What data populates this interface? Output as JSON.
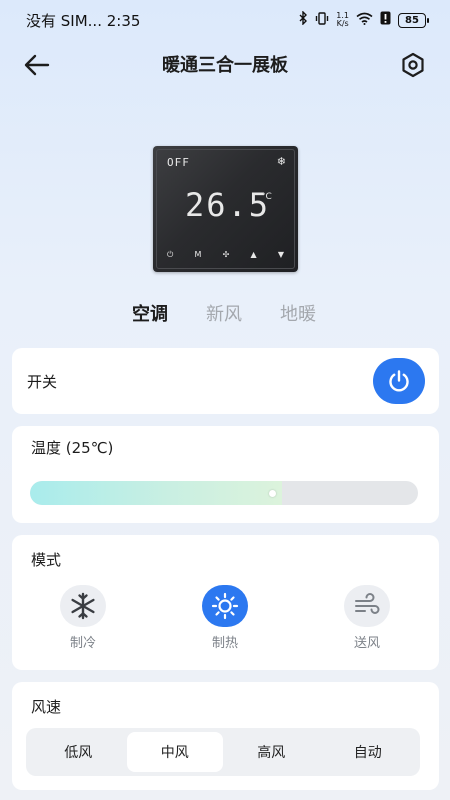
{
  "status_bar": {
    "carrier": "没有 SIM... 2:35",
    "net_speed_value": "1.1",
    "net_speed_unit": "K/s",
    "battery": "85"
  },
  "header": {
    "title": "暖通三合一展板"
  },
  "device_display": {
    "status_text": "OFF",
    "temperature": "26.5",
    "unit": "°C"
  },
  "tabs": [
    {
      "label": "空调",
      "active": true
    },
    {
      "label": "新风",
      "active": false
    },
    {
      "label": "地暖",
      "active": false
    }
  ],
  "power": {
    "label": "开关",
    "state": "on"
  },
  "temperature": {
    "label": "温度 (25℃)",
    "level": 0.65
  },
  "mode": {
    "label": "模式",
    "options": [
      {
        "label": "制冷",
        "icon": "snowflake-icon",
        "active": false
      },
      {
        "label": "制热",
        "icon": "sun-icon",
        "active": true
      },
      {
        "label": "送风",
        "icon": "wind-icon",
        "active": false
      }
    ]
  },
  "fan_speed": {
    "label": "风速",
    "options": [
      {
        "label": "低风",
        "active": false
      },
      {
        "label": "中风",
        "active": true
      },
      {
        "label": "高风",
        "active": false
      },
      {
        "label": "自动",
        "active": false
      }
    ]
  },
  "colors": {
    "accent": "#2c78f0",
    "background_top": "#dce9fb",
    "card": "#ffffff"
  }
}
